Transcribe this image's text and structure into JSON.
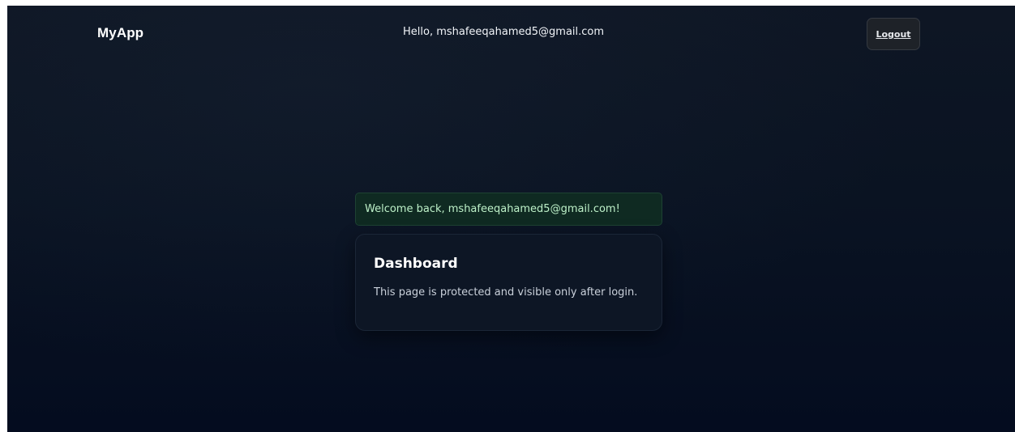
{
  "header": {
    "brand": "MyApp",
    "greeting": "Hello, mshafeeqahamed5@gmail.com",
    "logout_label": "Logout"
  },
  "flash": {
    "message": "Welcome back, mshafeeqahamed5@gmail.com!"
  },
  "card": {
    "title": "Dashboard",
    "text": "This page is protected and visible only after login."
  },
  "colors": {
    "background_top": "#0e1624",
    "background_bottom": "#040c1f",
    "flash_bg": "#0f2a22",
    "flash_text": "#bdf0c8",
    "card_bg": "#0d1625",
    "logout_bg": "#1e2228"
  }
}
